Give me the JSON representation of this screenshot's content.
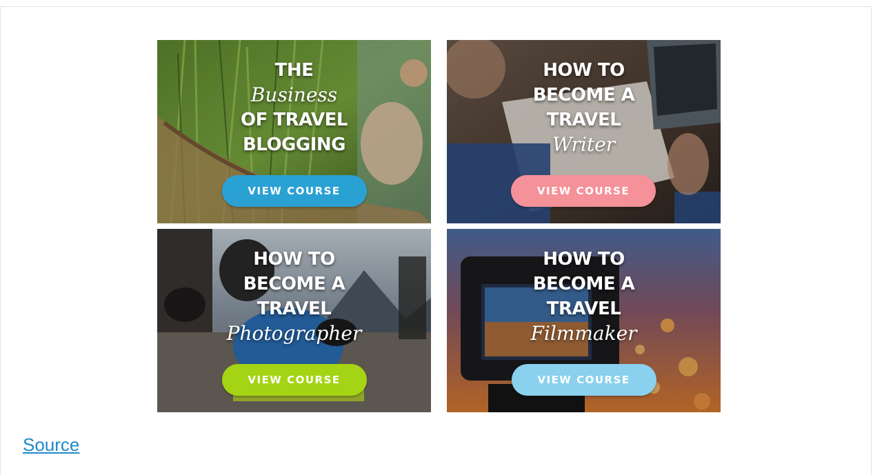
{
  "courses": [
    {
      "line1": "THE",
      "script": "Business",
      "line2": "OF TRAVEL",
      "line3": "BLOGGING",
      "button_label": "VIEW COURSE",
      "button_color": "#2aa1d3"
    },
    {
      "line1": "HOW TO",
      "line2": "BECOME A",
      "line3": "TRAVEL",
      "script": "Writer",
      "button_label": "VIEW COURSE",
      "button_color": "#f59199"
    },
    {
      "line1": "HOW TO",
      "line2": "BECOME A",
      "line3": "TRAVEL",
      "script": "Photographer",
      "button_label": "VIEW COURSE",
      "button_color": "#a5d414"
    },
    {
      "line1": "HOW TO",
      "line2": "BECOME A",
      "line3": "TRAVEL",
      "script": "Filmmaker",
      "button_label": "VIEW COURSE",
      "button_color": "#8ad0ef"
    }
  ],
  "source_link": "Source",
  "colors": {
    "link": "#1e88c9"
  }
}
